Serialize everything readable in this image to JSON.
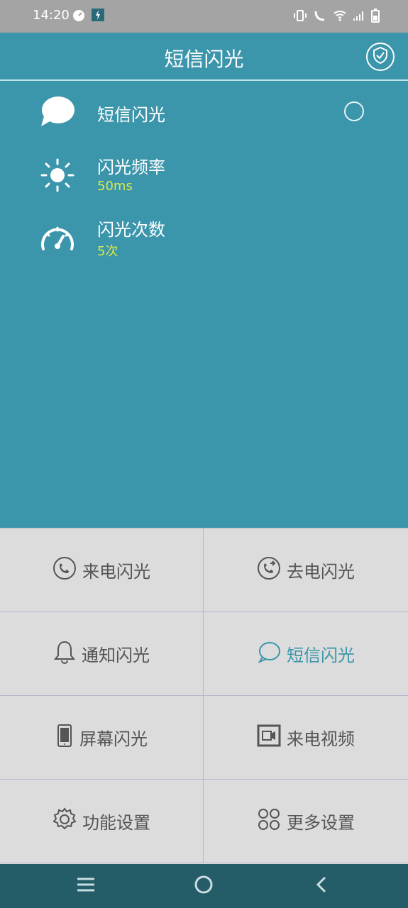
{
  "status_bar": {
    "time": "14:20"
  },
  "app_bar": {
    "title": "短信闪光"
  },
  "settings": [
    {
      "title": "短信闪光",
      "value": ""
    },
    {
      "title": "闪光频率",
      "value": "50ms"
    },
    {
      "title": "闪光次数",
      "value": "5次"
    }
  ],
  "menu": [
    {
      "label": "来电闪光",
      "icon": "phone-icon"
    },
    {
      "label": "去电闪光",
      "icon": "phone-outgoing-icon"
    },
    {
      "label": "通知闪光",
      "icon": "bell-icon"
    },
    {
      "label": "短信闪光",
      "icon": "chat-bubble-icon",
      "active": true
    },
    {
      "label": "屏幕闪光",
      "icon": "phone-device-icon"
    },
    {
      "label": "来电视频",
      "icon": "video-icon"
    },
    {
      "label": "功能设置",
      "icon": "gear-icon"
    },
    {
      "label": "更多设置",
      "icon": "grid-icon"
    }
  ],
  "colors": {
    "primary": "#3b95ab",
    "accent_value": "#d7e94a",
    "grid_bg": "#dcdcdc",
    "nav_bg": "#245c68"
  }
}
